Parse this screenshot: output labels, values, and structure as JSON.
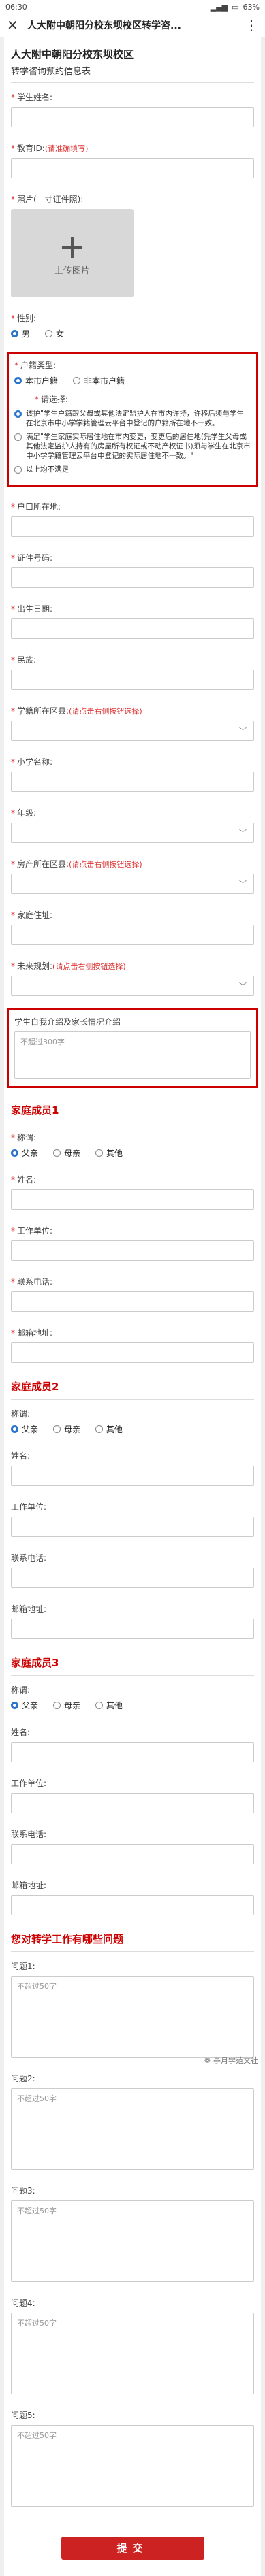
{
  "status": {
    "time": "06:30",
    "battery": "63%"
  },
  "titlebar": {
    "title": "人大附中朝阳分校东坝校区转学咨..."
  },
  "form": {
    "title": "人大附中朝阳分校东坝校区",
    "subtitle": "转学咨询预约信息表",
    "student_name": "学生姓名:",
    "education": "教育ID:",
    "education_hint": "(请准确填写)",
    "photo": "照片(一寸证件照):",
    "upload": "上传图片",
    "gender": "性别:",
    "gender_options": [
      "男",
      "女"
    ],
    "hukou_type": "户籍类型:",
    "hukou_options": [
      "本市户籍",
      "非本市户籍"
    ],
    "please_select": "请选择:",
    "hukou_reason_1": "该护\"学生户籍跟父母或其他法定监护人在市内许持，许移后须与学生在北京市中小学学籍管理云平台中登记的户籍所在地不一致。",
    "hukou_reason_2": "满足\"学生家庭实际居住地在市内变更，变更后的居住地(凭学生父母或其他法定监护人持有的房屋所有权证或不动产权证书)须与学生在北京市中小学学籍管理云平台中登记的实际居住地不一致。\"",
    "hukou_reason_3": "以上均不满足",
    "hukou_location": "户口所在地:",
    "id_number": "证件号码:",
    "birth_date": "出生日期:",
    "ethnicity": "民族:",
    "school_district": "学籍所在区县:",
    "school_district_hint": "(请点击右侧按钮选择)",
    "primary_school": "小学名称:",
    "grade": "年级:",
    "property_district": "房产所在区县:",
    "property_district_hint": "(请点击右侧按钮选择)",
    "home_address": "家庭住址:",
    "future_plan": "未来规划:",
    "future_plan_hint": "(请点击右侧按钮选择)",
    "student_intro": "学生自我介绍及家长情况介绍",
    "intro_placeholder": "不超过300字"
  },
  "family": [
    {
      "title": "家庭成员1",
      "relation": "称谓:",
      "relation_options": [
        "父亲",
        "母亲",
        "其他"
      ],
      "name": "姓名:",
      "work": "工作单位:",
      "phone": "联系电话:",
      "email": "邮箱地址:"
    },
    {
      "title": "家庭成员2",
      "relation": "称谓:",
      "relation_options": [
        "父亲",
        "母亲",
        "其他"
      ],
      "name": "姓名:",
      "work": "工作单位:",
      "phone": "联系电话:",
      "email": "邮箱地址:"
    },
    {
      "title": "家庭成员3",
      "relation": "称谓:",
      "relation_options": [
        "父亲",
        "母亲",
        "其他"
      ],
      "name": "姓名:",
      "work": "工作单位:",
      "phone": "联系电话:",
      "email": "邮箱地址:"
    }
  ],
  "questions": {
    "title": "您对转学工作有哪些问题",
    "items": [
      {
        "label": "问题1:",
        "placeholder": "不超过50字"
      },
      {
        "label": "问题2:",
        "placeholder": "不超过50字"
      },
      {
        "label": "问题3:",
        "placeholder": "不超过50字"
      },
      {
        "label": "问题4:",
        "placeholder": "不超过50字"
      },
      {
        "label": "问题5:",
        "placeholder": "不超过50字"
      }
    ]
  },
  "submit": "提交",
  "watermark": "亭月学范文社"
}
